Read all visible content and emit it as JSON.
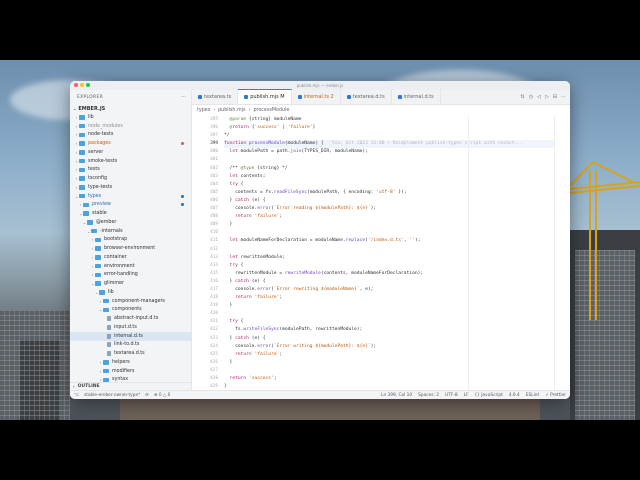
{
  "window": {
    "title": "publish.mjs — ember.js"
  },
  "sidebar": {
    "header": "EXPLORER",
    "section": "EMBER.JS",
    "outline": "OUTLINE",
    "items": [
      {
        "label": "lib",
        "kind": "folder",
        "depth": 1,
        "open": false
      },
      {
        "label": "node_modules",
        "kind": "folder",
        "depth": 1,
        "open": false,
        "muted": true
      },
      {
        "label": "node-tests",
        "kind": "folder",
        "depth": 1,
        "open": false
      },
      {
        "label": "packages",
        "kind": "folder",
        "depth": 1,
        "open": false,
        "color": "orange",
        "badge": "#e0506a"
      },
      {
        "label": "server",
        "kind": "folder",
        "depth": 1,
        "open": false
      },
      {
        "label": "smoke-tests",
        "kind": "folder",
        "depth": 1,
        "open": false
      },
      {
        "label": "tests",
        "kind": "folder",
        "depth": 1,
        "open": false
      },
      {
        "label": "tsconfig",
        "kind": "folder",
        "depth": 1,
        "open": false
      },
      {
        "label": "type-tests",
        "kind": "folder",
        "depth": 1,
        "open": false
      },
      {
        "label": "types",
        "kind": "folder",
        "depth": 1,
        "open": true,
        "color": "blue",
        "badge": "#2b6cb0"
      },
      {
        "label": "preview",
        "kind": "folder",
        "depth": 2,
        "open": false,
        "color": "blue",
        "badge": "#2b6cb0"
      },
      {
        "label": "stable",
        "kind": "folder",
        "depth": 2,
        "open": true
      },
      {
        "label": "@ember",
        "kind": "folder",
        "depth": 3,
        "open": true
      },
      {
        "label": "-internals",
        "kind": "folder",
        "depth": 4,
        "open": true
      },
      {
        "label": "bootstrap",
        "kind": "folder",
        "depth": 5,
        "open": false
      },
      {
        "label": "browser-environment",
        "kind": "folder",
        "depth": 5,
        "open": false
      },
      {
        "label": "container",
        "kind": "folder",
        "depth": 5,
        "open": false
      },
      {
        "label": "environment",
        "kind": "folder",
        "depth": 5,
        "open": false
      },
      {
        "label": "error-handling",
        "kind": "folder",
        "depth": 5,
        "open": false
      },
      {
        "label": "glimmer",
        "kind": "folder",
        "depth": 5,
        "open": true
      },
      {
        "label": "lib",
        "kind": "folder",
        "depth": 6,
        "open": true
      },
      {
        "label": "component-managers",
        "kind": "folder",
        "depth": 7,
        "open": false
      },
      {
        "label": "components",
        "kind": "folder",
        "depth": 7,
        "open": true
      },
      {
        "label": "abstract-input.d.ts",
        "kind": "file",
        "depth": 8
      },
      {
        "label": "input.d.ts",
        "kind": "file",
        "depth": 8
      },
      {
        "label": "internal.d.ts",
        "kind": "file",
        "depth": 8,
        "selected": true
      },
      {
        "label": "link-to.d.ts",
        "kind": "file",
        "depth": 8
      },
      {
        "label": "textarea.d.ts",
        "kind": "file",
        "depth": 8
      },
      {
        "label": "helpers",
        "kind": "folder",
        "depth": 7,
        "open": false
      },
      {
        "label": "modifiers",
        "kind": "folder",
        "depth": 7,
        "open": false
      },
      {
        "label": "syntax",
        "kind": "folder",
        "depth": 7,
        "open": false
      }
    ]
  },
  "tabs": [
    {
      "label": "textarea.ts",
      "active": false
    },
    {
      "label": "publish.mjs  M",
      "active": true
    },
    {
      "label": "internal.ts  2",
      "active": false,
      "modified": true
    },
    {
      "label": "textarea.d.ts",
      "active": false
    },
    {
      "label": "internal.d.ts",
      "active": false
    }
  ],
  "tab_actions": [
    "⇅",
    "◷",
    "◁",
    "▷",
    "⊟",
    "⋯"
  ],
  "breadcrumb": [
    "types",
    "publish.mjs",
    "processModule"
  ],
  "code": {
    "current_line": 399,
    "lines": [
      {
        "n": 395,
        "t": "  @param {string} moduleName"
      },
      {
        "n": 396,
        "t": "  @return {'success' | 'failure'}"
      },
      {
        "n": 397,
        "t": "*/"
      },
      {
        "n": 399,
        "t": "function processModule(moduleName) {",
        "ghost": "   You, Oct 2023 13:00 • Reimplement publish-types script with recast..."
      },
      {
        "n": 400,
        "t": "  let modulePath = path.join(TYPES_DIR, moduleName);"
      },
      {
        "n": 401,
        "t": ""
      },
      {
        "n": 402,
        "t": "  /** @type {string} */"
      },
      {
        "n": 403,
        "t": "  let contents;"
      },
      {
        "n": 404,
        "t": "  try {"
      },
      {
        "n": 405,
        "t": "    contents = fs.readFileSync(modulePath, { encoding: 'utf-8' });"
      },
      {
        "n": 406,
        "t": "  } catch (e) {"
      },
      {
        "n": 407,
        "t": "    console.error(`Error reading ${modulePath}: ${e}`);"
      },
      {
        "n": 408,
        "t": "    return 'failure';"
      },
      {
        "n": 409,
        "t": "  }"
      },
      {
        "n": 410,
        "t": ""
      },
      {
        "n": 411,
        "t": "  let moduleNameForDeclaration = moduleName.replace('/index.d.ts', '');"
      },
      {
        "n": 412,
        "t": ""
      },
      {
        "n": 413,
        "t": "  let rewrittenModule;"
      },
      {
        "n": 414,
        "t": "  try {"
      },
      {
        "n": 415,
        "t": "    rewrittenModule = rewriteModule(contents, moduleNameForDeclaration);"
      },
      {
        "n": 416,
        "t": "  } catch (e) {"
      },
      {
        "n": 417,
        "t": "    console.error(`Error rewriting ${moduleName}`, e);"
      },
      {
        "n": 418,
        "t": "    return 'failure';"
      },
      {
        "n": 419,
        "t": "  }"
      },
      {
        "n": 420,
        "t": ""
      },
      {
        "n": 421,
        "t": "  try {"
      },
      {
        "n": 422,
        "t": "    fs.writeFileSync(modulePath, rewrittenModule);"
      },
      {
        "n": 423,
        "t": "  } catch (e) {"
      },
      {
        "n": 424,
        "t": "    console.error(`Error writing ${modulePath}: ${e}`);"
      },
      {
        "n": 425,
        "t": "    return 'failure';"
      },
      {
        "n": 426,
        "t": "  }"
      },
      {
        "n": 427,
        "t": ""
      },
      {
        "n": 428,
        "t": "  return 'success';"
      },
      {
        "n": 429,
        "t": "}"
      }
    ]
  },
  "status": {
    "branch": "stable-ember-owner-type*",
    "sync": "⟳",
    "problems": "⊗ 0 △ 0",
    "cursor": "Ln 399, Col 10",
    "spaces": "Spaces: 2",
    "encoding": "UTF-8",
    "eol": "LF",
    "language": "{} JavaScript",
    "ts_version": "4.6.4",
    "eslint": "ESLint",
    "prettier": "✓ Prettier"
  },
  "colors": {
    "accent": "#2f7fe0",
    "folder": "#4aa3df",
    "modified": "#c2620b"
  }
}
